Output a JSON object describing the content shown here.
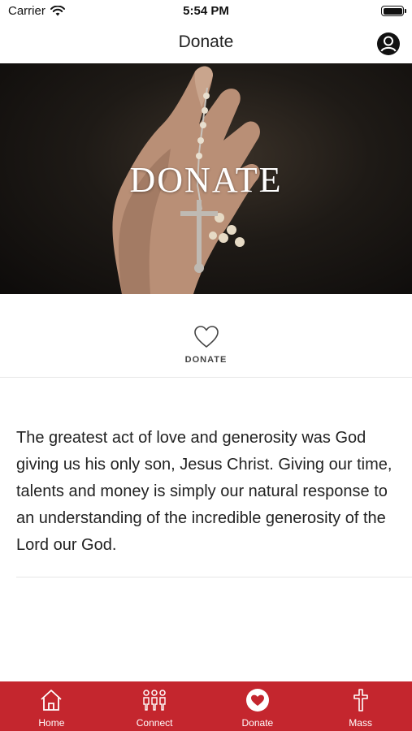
{
  "status_bar": {
    "carrier": "Carrier",
    "time": "5:54 PM"
  },
  "nav": {
    "title": "Donate",
    "profile_icon": "person-circle-icon"
  },
  "hero": {
    "title": "DONATE",
    "image": "hand-holding-rosary"
  },
  "donate_action": {
    "label": "DONATE",
    "icon": "heart-icon"
  },
  "content": {
    "text": "The greatest act of love and generosity was God giving us his only son, Jesus Christ. Giving our time, talents and money is simply our natural response to an understanding of the incredible generosity of the Lord our God."
  },
  "tab_bar": {
    "color": "#c4262e",
    "tabs": [
      {
        "label": "Home",
        "icon": "home-icon"
      },
      {
        "label": "Connect",
        "icon": "people-icon"
      },
      {
        "label": "Donate",
        "icon": "heart-circle-icon",
        "active": true
      },
      {
        "label": "Mass",
        "icon": "cross-icon"
      }
    ]
  }
}
